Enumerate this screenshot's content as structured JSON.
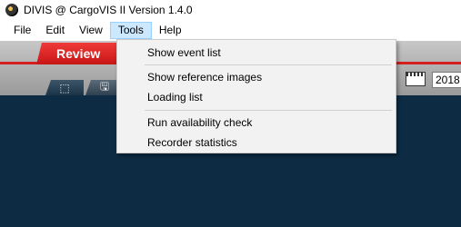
{
  "window": {
    "title": "DIVIS @ CargoVIS II Version 1.4.0"
  },
  "menubar": {
    "items": [
      "File",
      "Edit",
      "View",
      "Tools",
      "Help"
    ],
    "active": "Tools"
  },
  "toolbar": {
    "review_label": "Review",
    "tab1_glyph": "⬚",
    "tab2_glyph": "🖫",
    "year_value": "2018"
  },
  "tools_menu": {
    "items": [
      "Show event list",
      "Show reference images",
      "Loading list",
      "Run availability check",
      "Recorder statistics"
    ]
  },
  "colors": {
    "review_red": "#e02222",
    "workspace_bg": "#0d2c44",
    "menu_highlight": "#cce8ff"
  }
}
